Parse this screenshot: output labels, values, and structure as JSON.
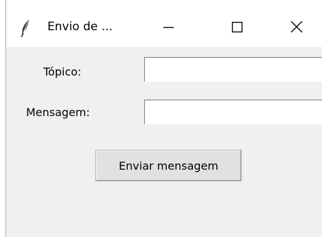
{
  "window": {
    "title": "Envio de ...",
    "app_icon": "feather-icon",
    "controls": [
      "minimize-icon",
      "maximize-icon",
      "close-icon"
    ]
  },
  "form": {
    "topic_label": "Tópico:",
    "topic_value": "",
    "message_label": "Mensagem:",
    "message_value": "",
    "send_button_label": "Enviar mensagem"
  }
}
